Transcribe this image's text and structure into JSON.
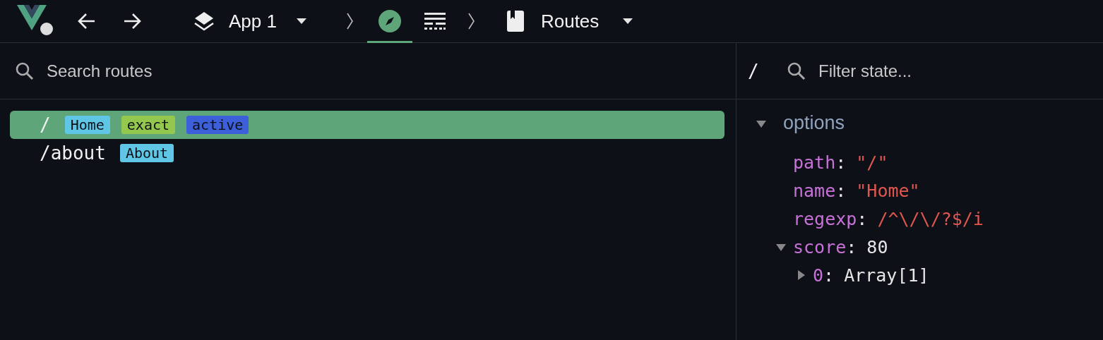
{
  "toolbar": {
    "app": "App 1",
    "page": "Routes",
    "tabs": [
      {
        "kind": "inspector",
        "selected": true
      },
      {
        "kind": "timeline",
        "selected": false
      }
    ]
  },
  "routes": {
    "placeholder": "Search routes",
    "items": [
      {
        "path": "/",
        "selected": true,
        "tags": [
          {
            "label": "Home",
            "kind": "name"
          },
          {
            "label": "exact",
            "kind": "exact"
          },
          {
            "label": "active",
            "kind": "active"
          }
        ]
      },
      {
        "path": "/about",
        "selected": false,
        "tags": [
          {
            "label": "About",
            "kind": "name"
          }
        ]
      }
    ]
  },
  "state": {
    "path": "/",
    "placeholder": "Filter state...",
    "section": {
      "label": "options",
      "expanded": true
    },
    "entries": [
      {
        "key": "path",
        "sep": ":",
        "value": "\"/\"",
        "kind": "string"
      },
      {
        "key": "name",
        "sep": ":",
        "value": "\"Home\"",
        "kind": "string"
      },
      {
        "key": "regexp",
        "sep": ":",
        "value": "/^\\/\\/?$/i",
        "kind": "string"
      },
      {
        "key": "score",
        "sep": ":",
        "value": "80",
        "kind": "number",
        "expanded": true,
        "children": [
          {
            "key": "0",
            "sep": ":",
            "value": "Array[1]",
            "kind": "object",
            "expanded": false
          }
        ]
      }
    ]
  }
}
